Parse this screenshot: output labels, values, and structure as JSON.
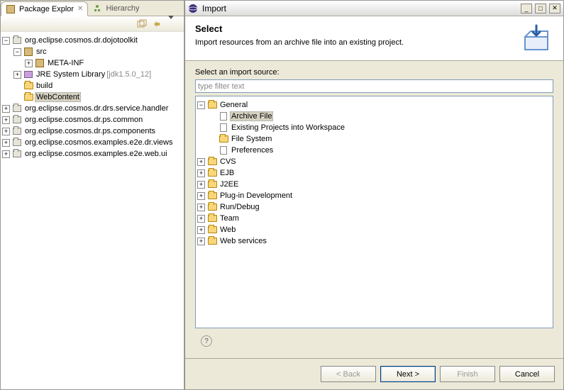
{
  "leftPanel": {
    "tabs": {
      "active": "Package Explor",
      "inactive": "Hierarchy"
    },
    "tree": [
      {
        "depth": 0,
        "exp": "-",
        "icon": "proj",
        "label": "org.eclipse.cosmos.dr.dojotoolkit"
      },
      {
        "depth": 1,
        "exp": "-",
        "icon": "pkg",
        "label": "src"
      },
      {
        "depth": 2,
        "exp": "+",
        "icon": "pkg",
        "label": "META-INF"
      },
      {
        "depth": 1,
        "exp": "+",
        "icon": "lib",
        "label": "JRE System Library",
        "suffix": "[jdk1.5.0_12]"
      },
      {
        "depth": 1,
        "exp": "",
        "icon": "folder",
        "label": "build"
      },
      {
        "depth": 1,
        "exp": "",
        "icon": "folder",
        "label": "WebContent",
        "selected": true
      },
      {
        "depth": 0,
        "exp": "+",
        "icon": "proj",
        "label": "org.eclipse.cosmos.dr.drs.service.handler"
      },
      {
        "depth": 0,
        "exp": "+",
        "icon": "proj",
        "label": "org.eclipse.cosmos.dr.ps.common"
      },
      {
        "depth": 0,
        "exp": "+",
        "icon": "proj",
        "label": "org.eclipse.cosmos.dr.ps.components"
      },
      {
        "depth": 0,
        "exp": "+",
        "icon": "proj",
        "label": "org.eclipse.cosmos.examples.e2e.dr.views"
      },
      {
        "depth": 0,
        "exp": "+",
        "icon": "proj",
        "label": "org.eclipse.cosmos.examples.e2e.web.ui"
      }
    ]
  },
  "dialog": {
    "title": "Import",
    "banner": {
      "heading": "Select",
      "description": "Import resources from an archive file into an existing project."
    },
    "sourceLabel": "Select an import source:",
    "filterPlaceholder": "type filter text",
    "tree": [
      {
        "depth": 0,
        "exp": "-",
        "icon": "folder",
        "label": "General"
      },
      {
        "depth": 1,
        "exp": "",
        "icon": "file",
        "label": "Archive File",
        "selected": true
      },
      {
        "depth": 1,
        "exp": "",
        "icon": "file",
        "label": "Existing Projects into Workspace"
      },
      {
        "depth": 1,
        "exp": "",
        "icon": "folder",
        "label": "File System"
      },
      {
        "depth": 1,
        "exp": "",
        "icon": "file",
        "label": "Preferences"
      },
      {
        "depth": 0,
        "exp": "+",
        "icon": "folder",
        "label": "CVS"
      },
      {
        "depth": 0,
        "exp": "+",
        "icon": "folder",
        "label": "EJB"
      },
      {
        "depth": 0,
        "exp": "+",
        "icon": "folder",
        "label": "J2EE"
      },
      {
        "depth": 0,
        "exp": "+",
        "icon": "folder",
        "label": "Plug-in Development"
      },
      {
        "depth": 0,
        "exp": "+",
        "icon": "folder",
        "label": "Run/Debug"
      },
      {
        "depth": 0,
        "exp": "+",
        "icon": "folder",
        "label": "Team"
      },
      {
        "depth": 0,
        "exp": "+",
        "icon": "folder",
        "label": "Web"
      },
      {
        "depth": 0,
        "exp": "+",
        "icon": "folder",
        "label": "Web services"
      }
    ],
    "buttons": {
      "back": "< Back",
      "next": "Next >",
      "finish": "Finish",
      "cancel": "Cancel"
    }
  }
}
